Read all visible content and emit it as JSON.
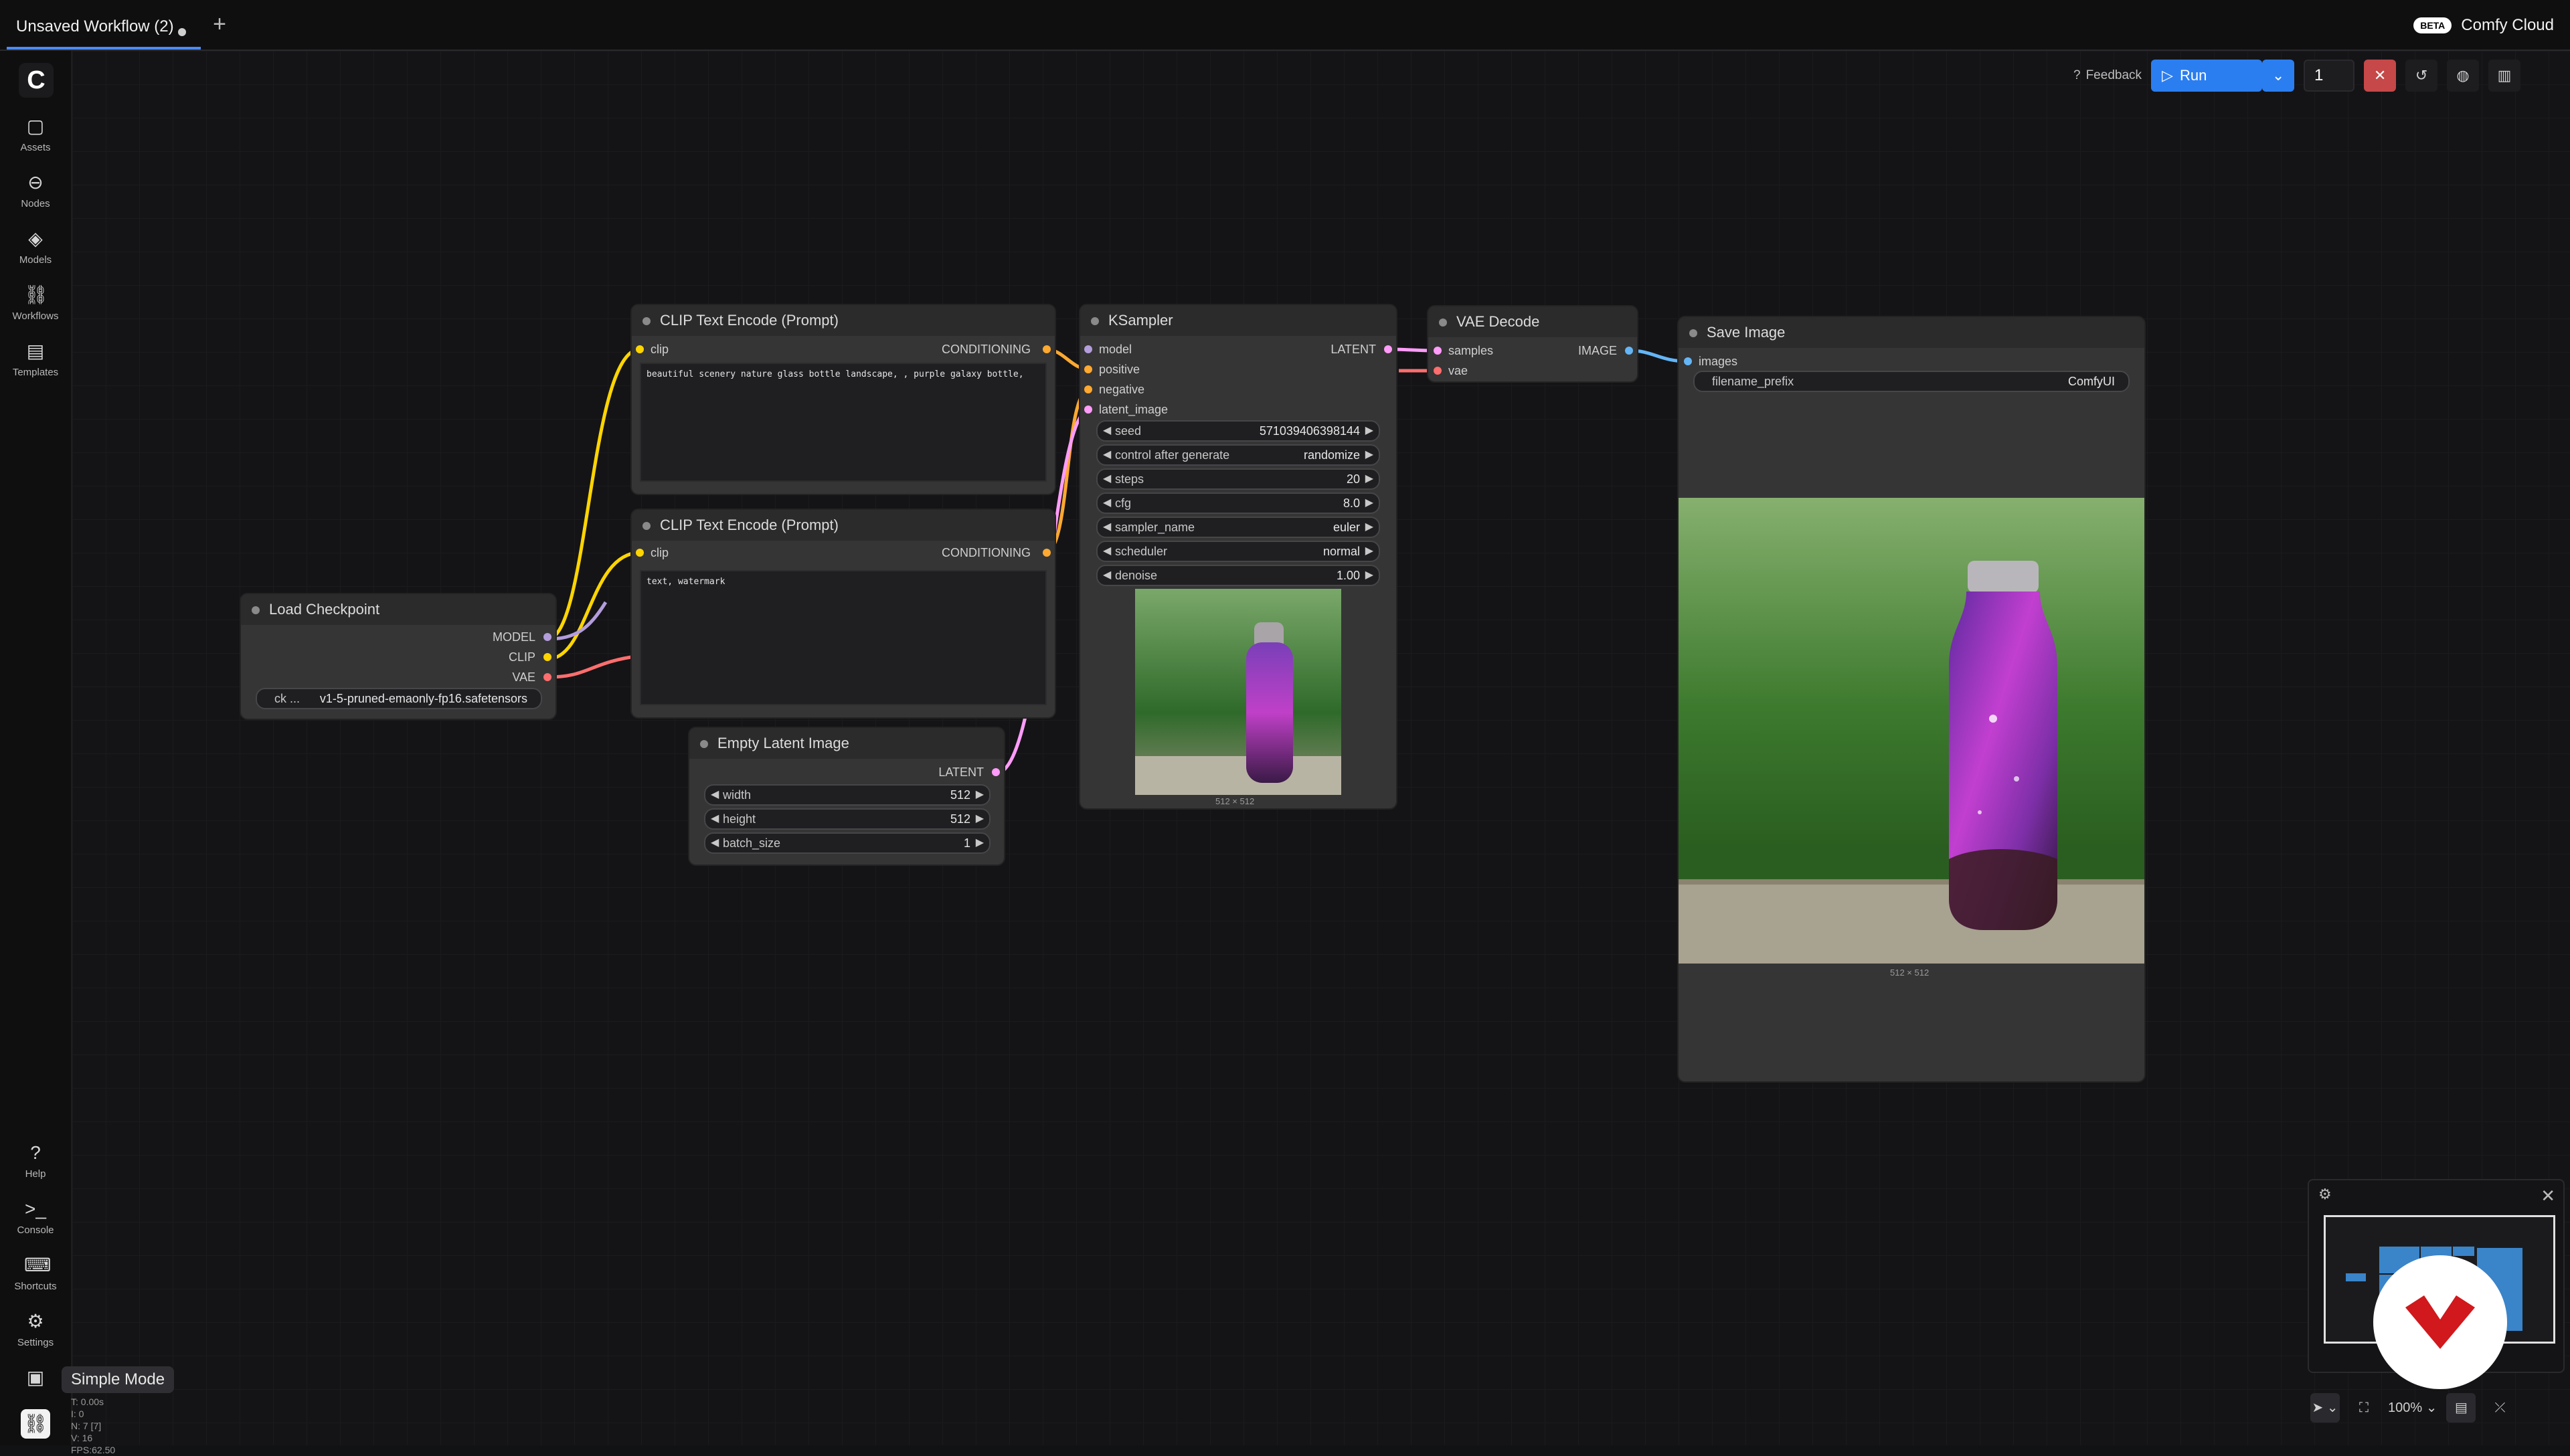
{
  "tab": {
    "title": "Unsaved Workflow (2)",
    "add_icon": "+"
  },
  "cloud": {
    "badge": "BETA",
    "name": "Comfy Cloud"
  },
  "sidebar": {
    "logo": "C",
    "items": [
      {
        "label": "Assets",
        "icon": "▢"
      },
      {
        "label": "Nodes",
        "icon": "⊖"
      },
      {
        "label": "Models",
        "icon": "◈"
      },
      {
        "label": "Workflows",
        "icon": "⛓"
      },
      {
        "label": "Templates",
        "icon": "▤"
      }
    ],
    "bottom_items": [
      {
        "label": "Help",
        "icon": "?"
      },
      {
        "label": "Console",
        "icon": ">_"
      },
      {
        "label": "Shortcuts",
        "icon": "⌨"
      },
      {
        "label": "Settings",
        "icon": "⚙"
      }
    ],
    "simple_mode_tooltip": "Simple Mode"
  },
  "toolbar": {
    "feedback": "Feedback",
    "run": "Run",
    "count": "1"
  },
  "nodes": {
    "clip1": {
      "title": "CLIP Text Encode (Prompt)",
      "input": "clip",
      "output": "CONDITIONING",
      "text": "beautiful scenery nature glass bottle landscape, , purple galaxy bottle,"
    },
    "clip2": {
      "title": "CLIP Text Encode (Prompt)",
      "input": "clip",
      "output": "CONDITIONING",
      "text": "text, watermark"
    },
    "checkpoint": {
      "title": "Load Checkpoint",
      "outputs": [
        "MODEL",
        "CLIP",
        "VAE"
      ],
      "widget_name": "ck ...",
      "widget_value": "v1-5-pruned-emaonly-fp16.safetensors"
    },
    "latent": {
      "title": "Empty Latent Image",
      "output": "LATENT",
      "widgets": [
        {
          "name": "width",
          "value": "512"
        },
        {
          "name": "height",
          "value": "512"
        },
        {
          "name": "batch_size",
          "value": "1"
        }
      ]
    },
    "ksampler": {
      "title": "KSampler",
      "inputs": [
        "model",
        "positive",
        "negative",
        "latent_image"
      ],
      "output": "LATENT",
      "widgets": [
        {
          "name": "seed",
          "value": "571039406398144"
        },
        {
          "name": "control after generate",
          "value": "randomize"
        },
        {
          "name": "steps",
          "value": "20"
        },
        {
          "name": "cfg",
          "value": "8.0"
        },
        {
          "name": "sampler_name",
          "value": "euler"
        },
        {
          "name": "scheduler",
          "value": "normal"
        },
        {
          "name": "denoise",
          "value": "1.00"
        }
      ],
      "preview_caption": "512 × 512"
    },
    "vae": {
      "title": "VAE Decode",
      "inputs": [
        "samples",
        "vae"
      ],
      "output": "IMAGE"
    },
    "save": {
      "title": "Save Image",
      "input": "images",
      "widget_name": "filename_prefix",
      "widget_value": "ComfyUI",
      "caption": "512 × 512"
    }
  },
  "status": {
    "line1": "T: 0.00s",
    "line2": "I: 0",
    "line3": "N: 7 [7]",
    "line4": "V: 16",
    "line5": "FPS:62.50"
  },
  "zoom": "100%",
  "colors": {
    "accent": "#2b7ef0",
    "clip": "#ffd500",
    "conditioning": "#ffa931",
    "latent": "#ff9cf9",
    "vae": "#ff6e6e",
    "image": "#64b5f6",
    "model": "#b39ddb"
  }
}
